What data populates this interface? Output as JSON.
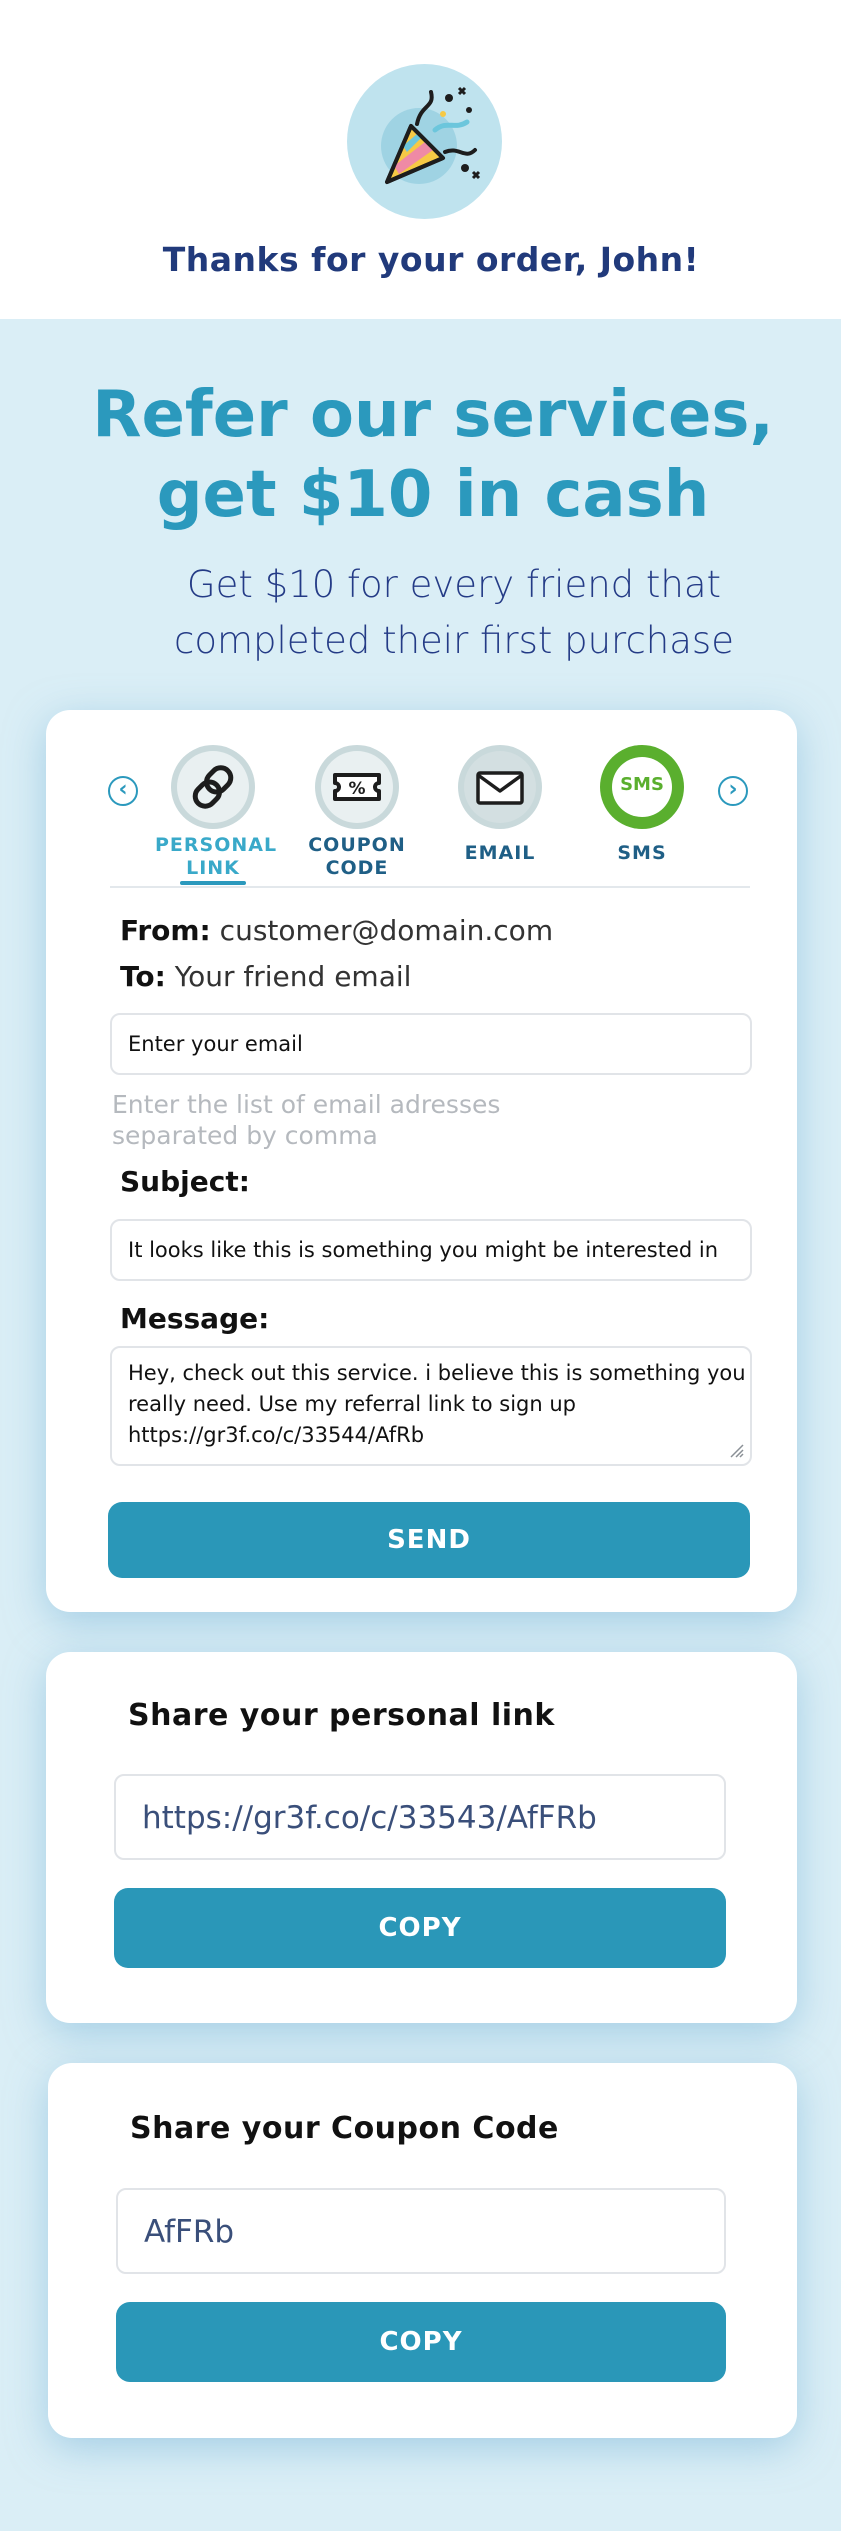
{
  "header": {
    "thanks_text": "Thanks for your order, John!",
    "icon": "party-popper-icon"
  },
  "hero": {
    "title_line1": "Refer our services,",
    "title_line2": "get $10 in cash",
    "subtitle_line1": "Get $10 for every friend that",
    "subtitle_line2": "completed their first purchase"
  },
  "tabs": [
    {
      "line1": "PERSONAL",
      "line2": "LINK",
      "icon": "chain-link-icon",
      "active": true
    },
    {
      "line1": "COUPON",
      "line2": "CODE",
      "icon": "coupon-ticket-icon",
      "active": false
    },
    {
      "line1": "EMAIL",
      "line2": "",
      "icon": "envelope-icon",
      "active": false
    },
    {
      "line1": "SMS",
      "line2": "",
      "icon": "sms-bubble-icon",
      "active": false
    }
  ],
  "sms_badge": "SMS",
  "email_form": {
    "from_label": "From:",
    "from_value": "customer@domain.com",
    "to_label": "To:",
    "to_value": "Your friend email",
    "email_placeholder": "Enter your email",
    "hint_line1": "Enter the list of email adresses",
    "hint_line2": "separated by comma",
    "subject_label": "Subject:",
    "subject_value": "It looks like this is something you might be interested in",
    "message_label": "Message:",
    "message_line1": "Hey, check out this service. i believe this is something you",
    "message_line2": "really need. Use my referral link to sign up",
    "message_line3": "https://gr3f.co/c/33544/AfRb",
    "send_label": "SEND"
  },
  "personal_link": {
    "title": "Share your personal link",
    "value": "https://gr3f.co/c/33543/AfFRb",
    "copy_label": "COPY"
  },
  "coupon": {
    "title": "Share your Coupon Code",
    "value": "AfFRb",
    "copy_label": "COPY"
  },
  "colors": {
    "accent": "#2a97b8",
    "navy": "#213a7b",
    "band": "#daeef6",
    "sms_green": "#5aaf2e"
  }
}
